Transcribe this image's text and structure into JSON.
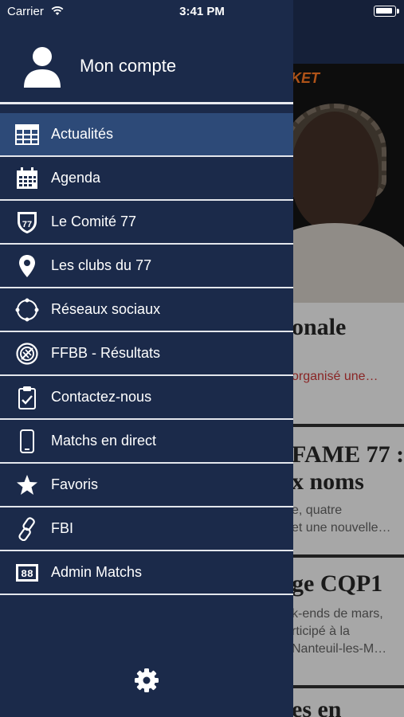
{
  "status_bar": {
    "carrier": "Carrier",
    "time": "3:41 PM"
  },
  "account": {
    "label": "Mon compte"
  },
  "menu": {
    "items": [
      {
        "label": "Actualités",
        "icon": "newspaper-icon",
        "active": true
      },
      {
        "label": "Agenda",
        "icon": "calendar-icon"
      },
      {
        "label": "Le Comité 77",
        "icon": "shield-77-icon"
      },
      {
        "label": "Les clubs du 77",
        "icon": "map-pin-icon"
      },
      {
        "label": "Réseaux sociaux",
        "icon": "network-icon"
      },
      {
        "label": "FFBB - Résultats",
        "icon": "basketball-icon"
      },
      {
        "label": "Contactez-nous",
        "icon": "clipboard-check-icon"
      },
      {
        "label": "Matchs en direct",
        "icon": "phone-icon"
      },
      {
        "label": "Favoris",
        "icon": "star-icon"
      },
      {
        "label": "FBI",
        "icon": "link-icon"
      },
      {
        "label": "Admin Matchs",
        "icon": "scoreboard-icon"
      }
    ]
  },
  "background": {
    "banner": "ASKET",
    "card1": {
      "title": "onale",
      "text": "organisé une…"
    },
    "card2": {
      "title1": "FAME 77 :",
      "title2": "x noms",
      "line1": "e, quatre",
      "line2": "et une nouvelle…"
    },
    "card3": {
      "title": "ge CQP1",
      "line1": "k-ends de mars,",
      "line2": "rticipé à la",
      "line3": "Nanteuil-les-M…"
    },
    "card4": {
      "title": "es en"
    }
  },
  "colors": {
    "drawer_bg": "#1b2a4a",
    "active_bg": "#2d4a78",
    "separator": "#e3e6ec"
  }
}
